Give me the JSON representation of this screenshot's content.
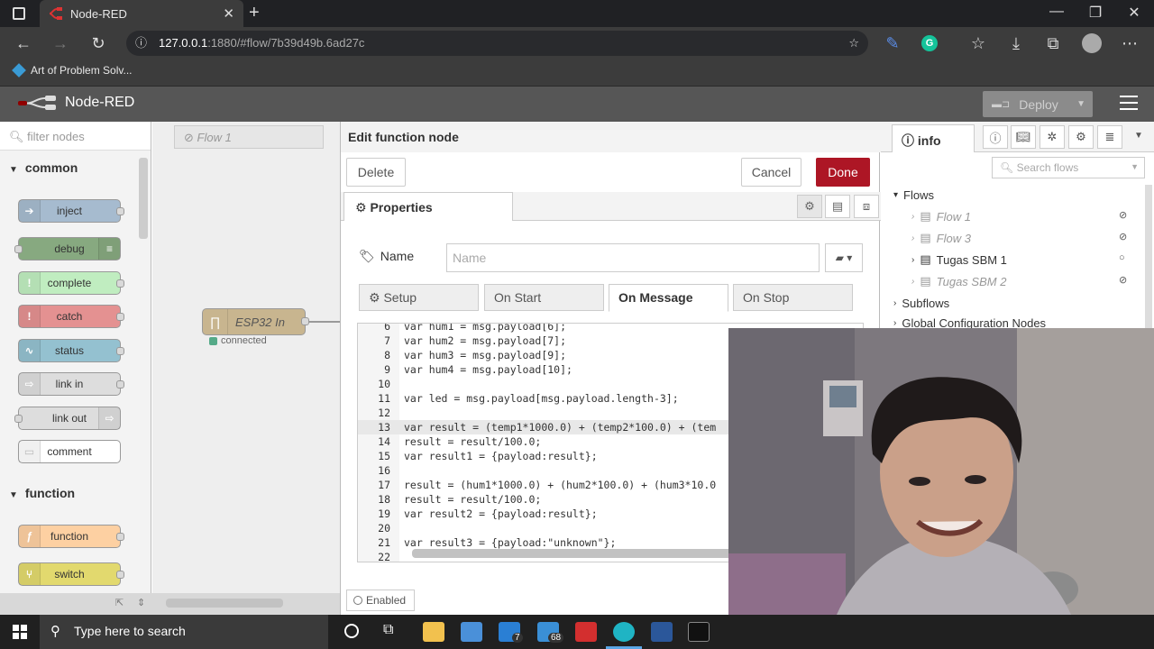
{
  "browser": {
    "tab_title": "Node-RED",
    "url_host": "127.0.0.1",
    "url_rest": ":1880/#flow/7b39d49b.6ad27c",
    "bookmark": "Art of Problem Solv..."
  },
  "app": {
    "brand": "Node-RED",
    "deploy_label": "Deploy"
  },
  "palette": {
    "search_placeholder": "filter nodes",
    "categories": [
      "common",
      "function"
    ],
    "nodes": [
      "inject",
      "debug",
      "complete",
      "catch",
      "status",
      "link in",
      "link out",
      "comment",
      "function",
      "switch"
    ]
  },
  "workspace": {
    "flow_tab": "Flow 1",
    "node_label": "ESP32 In",
    "node_status": "connected"
  },
  "editor": {
    "title": "Edit function node",
    "delete_label": "Delete",
    "cancel_label": "Cancel",
    "done_label": "Done",
    "properties_tab": "Properties",
    "name_label": "Name",
    "name_placeholder": "Name",
    "subtabs": [
      "Setup",
      "On Start",
      "On Message",
      "On Stop"
    ],
    "enabled_label": "Enabled",
    "code_lines": [
      {
        "n": "6",
        "t": "var hum1 = msg.payload[6];"
      },
      {
        "n": "7",
        "t": "var hum2 = msg.payload[7];"
      },
      {
        "n": "8",
        "t": "var hum3 = msg.payload[9];"
      },
      {
        "n": "9",
        "t": "var hum4 = msg.payload[10];"
      },
      {
        "n": "10",
        "t": ""
      },
      {
        "n": "11",
        "t": "var led = msg.payload[msg.payload.length-3];"
      },
      {
        "n": "12",
        "t": ""
      },
      {
        "n": "13",
        "t": "var result = (temp1*1000.0) + (temp2*100.0) + (tem"
      },
      {
        "n": "14",
        "t": "result = result/100.0;"
      },
      {
        "n": "15",
        "t": "var result1 = {payload:result};"
      },
      {
        "n": "16",
        "t": ""
      },
      {
        "n": "17",
        "t": "result = (hum1*1000.0) + (hum2*100.0) + (hum3*10.0"
      },
      {
        "n": "18",
        "t": "result = result/100.0;"
      },
      {
        "n": "19",
        "t": "var result2 = {payload:result};"
      },
      {
        "n": "20",
        "t": ""
      },
      {
        "n": "21",
        "t": "var result3 = {payload:\"unknown\"};"
      },
      {
        "n": "22",
        "t": ""
      }
    ]
  },
  "sidebar": {
    "tab_label": "info",
    "search_placeholder": "Search flows",
    "flows_label": "Flows",
    "flows": [
      "Flow 1",
      "Flow 3",
      "Tugas SBM 1",
      "Tugas SBM 2"
    ],
    "subflows_label": "Subflows",
    "global_label": "Global Configuration Nodes"
  },
  "taskbar": {
    "search_placeholder": "Type here to search",
    "mail_badge": "7",
    "files_badge": "68"
  }
}
